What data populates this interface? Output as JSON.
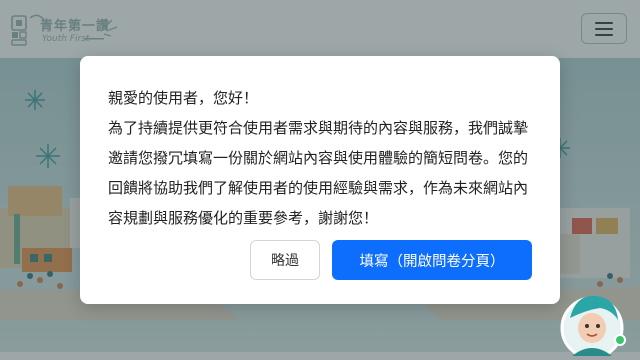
{
  "header": {
    "logo_text": "青年第一讚",
    "logo_subtext": "Youth First",
    "menu_icon": "hamburger-menu-icon"
  },
  "modal": {
    "greeting": "親愛的使用者，您好！",
    "body": "為了持續提供更符合使用者需求與期待的內容與服務，我們誠摯邀請您撥冗填寫一份關於網站內容與使用體驗的簡短問卷。您的回饋將協助我們了解使用者的使用經驗與需求，作為未來網站內容規劃與服務優化的重要參考，謝謝您！",
    "skip_label": "略過",
    "fill_label": "填寫（開啟問卷分頁）"
  },
  "colors": {
    "primary": "#0d6efd",
    "accent_teal": "#3aa6a6",
    "overlay": "rgba(40,60,62,0.45)"
  }
}
